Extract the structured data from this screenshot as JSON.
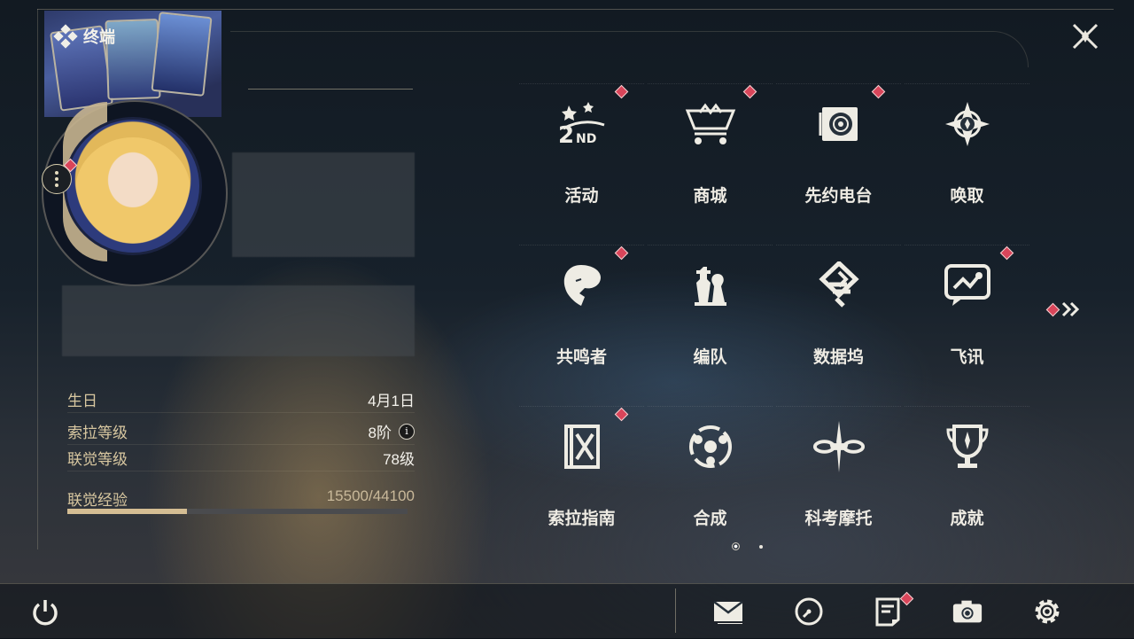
{
  "header": {
    "title": "终端",
    "close_icon": "close-x-icon"
  },
  "profile": {
    "more_icon": "more-vertical-icon",
    "stats": [
      {
        "label": "生日",
        "value": "4月1日"
      },
      {
        "label": "索拉等级",
        "value": "8阶"
      },
      {
        "label": "联觉等级",
        "value": "78级"
      }
    ],
    "info_icon_glyph": "i",
    "exp": {
      "label": "联觉经验",
      "value": "15500/44100",
      "fraction": 0.3515
    }
  },
  "menu": {
    "items": [
      {
        "label": "活动",
        "icon": "event-2nd-icon",
        "badge": true
      },
      {
        "label": "商城",
        "icon": "shop-cart-icon",
        "badge": true
      },
      {
        "label": "先约电台",
        "icon": "radio-station-icon",
        "badge": true
      },
      {
        "label": "唤取",
        "icon": "summon-compass-icon",
        "badge": false
      },
      {
        "label": "共鸣者",
        "icon": "resonator-icon",
        "badge": true
      },
      {
        "label": "编队",
        "icon": "chess-team-icon",
        "badge": false
      },
      {
        "label": "数据坞",
        "icon": "data-dock-icon",
        "badge": false
      },
      {
        "label": "飞讯",
        "icon": "message-chat-icon",
        "badge": true
      },
      {
        "label": "索拉指南",
        "icon": "guide-book-icon",
        "badge": true
      },
      {
        "label": "合成",
        "icon": "synthesis-icon",
        "badge": false
      },
      {
        "label": "科考摩托",
        "icon": "motorbike-icon",
        "badge": false
      },
      {
        "label": "成就",
        "icon": "trophy-icon",
        "badge": false
      }
    ],
    "next_page_icon": "double-chevron-right-icon",
    "page": 1,
    "page_count": 2
  },
  "bottom_bar": {
    "power_icon": "power-icon",
    "buttons": [
      "mail-icon",
      "clock-icon",
      "notes-icon",
      "camera-icon",
      "settings-gear-icon"
    ]
  },
  "colors": {
    "badge": "#d9455a",
    "accent_gold": "#d4bd93"
  }
}
